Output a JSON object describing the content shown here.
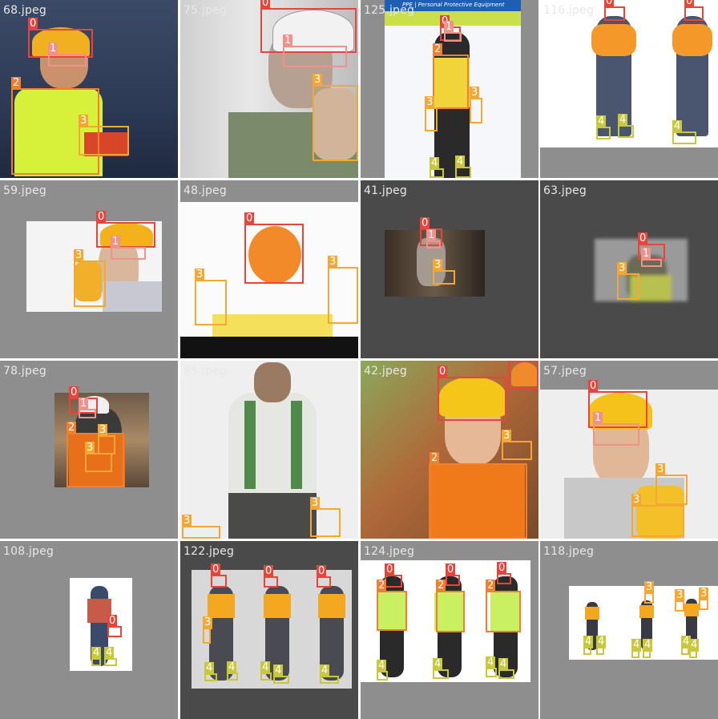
{
  "class_colors": {
    "0": "#e8443a",
    "1": "#f0928c",
    "2": "#f08030",
    "3": "#f4a833",
    "4": "#c8c83a"
  },
  "tiles": [
    {
      "filename": "68.jpeg",
      "labels": [
        "0",
        "1",
        "2",
        "3"
      ]
    },
    {
      "filename": "75.jpeg",
      "labels": [
        "0",
        "1",
        "3"
      ]
    },
    {
      "filename": "125.jpeg",
      "labels": [
        "0",
        "1",
        "2",
        "3",
        "3",
        "4",
        "4"
      ],
      "poster_title": "PPE | Personal Protective Equipment"
    },
    {
      "filename": "116.jpeg",
      "labels": [
        "0",
        "0",
        "4",
        "4",
        "4"
      ]
    },
    {
      "filename": "59.jpeg",
      "labels": [
        "0",
        "1",
        "3"
      ]
    },
    {
      "filename": "48.jpeg",
      "labels": [
        "0",
        "3",
        "3"
      ]
    },
    {
      "filename": "41.jpeg",
      "labels": [
        "0",
        "1",
        "3"
      ]
    },
    {
      "filename": "63.jpeg",
      "labels": [
        "0",
        "1",
        "3"
      ]
    },
    {
      "filename": "78.jpeg",
      "labels": [
        "0",
        "1",
        "2",
        "3",
        "3"
      ]
    },
    {
      "filename": "85.jpeg",
      "labels": [
        "3",
        "3"
      ]
    },
    {
      "filename": "42.jpeg",
      "labels": [
        "0",
        "0",
        "2",
        "3"
      ]
    },
    {
      "filename": "57.jpeg",
      "labels": [
        "0",
        "1",
        "3",
        "3"
      ]
    },
    {
      "filename": "108.jpeg",
      "labels": [
        "0",
        "4",
        "4"
      ]
    },
    {
      "filename": "122.jpeg",
      "labels": [
        "0",
        "0",
        "0",
        "3",
        "4",
        "4",
        "4",
        "4",
        "4"
      ]
    },
    {
      "filename": "124.jpeg",
      "labels": [
        "0",
        "0",
        "0",
        "2",
        "2",
        "2",
        "4",
        "4",
        "4",
        "4"
      ]
    },
    {
      "filename": "118.jpeg",
      "labels": [
        "3",
        "3",
        "3",
        "4",
        "4",
        "4",
        "4",
        "4",
        "4"
      ]
    }
  ]
}
